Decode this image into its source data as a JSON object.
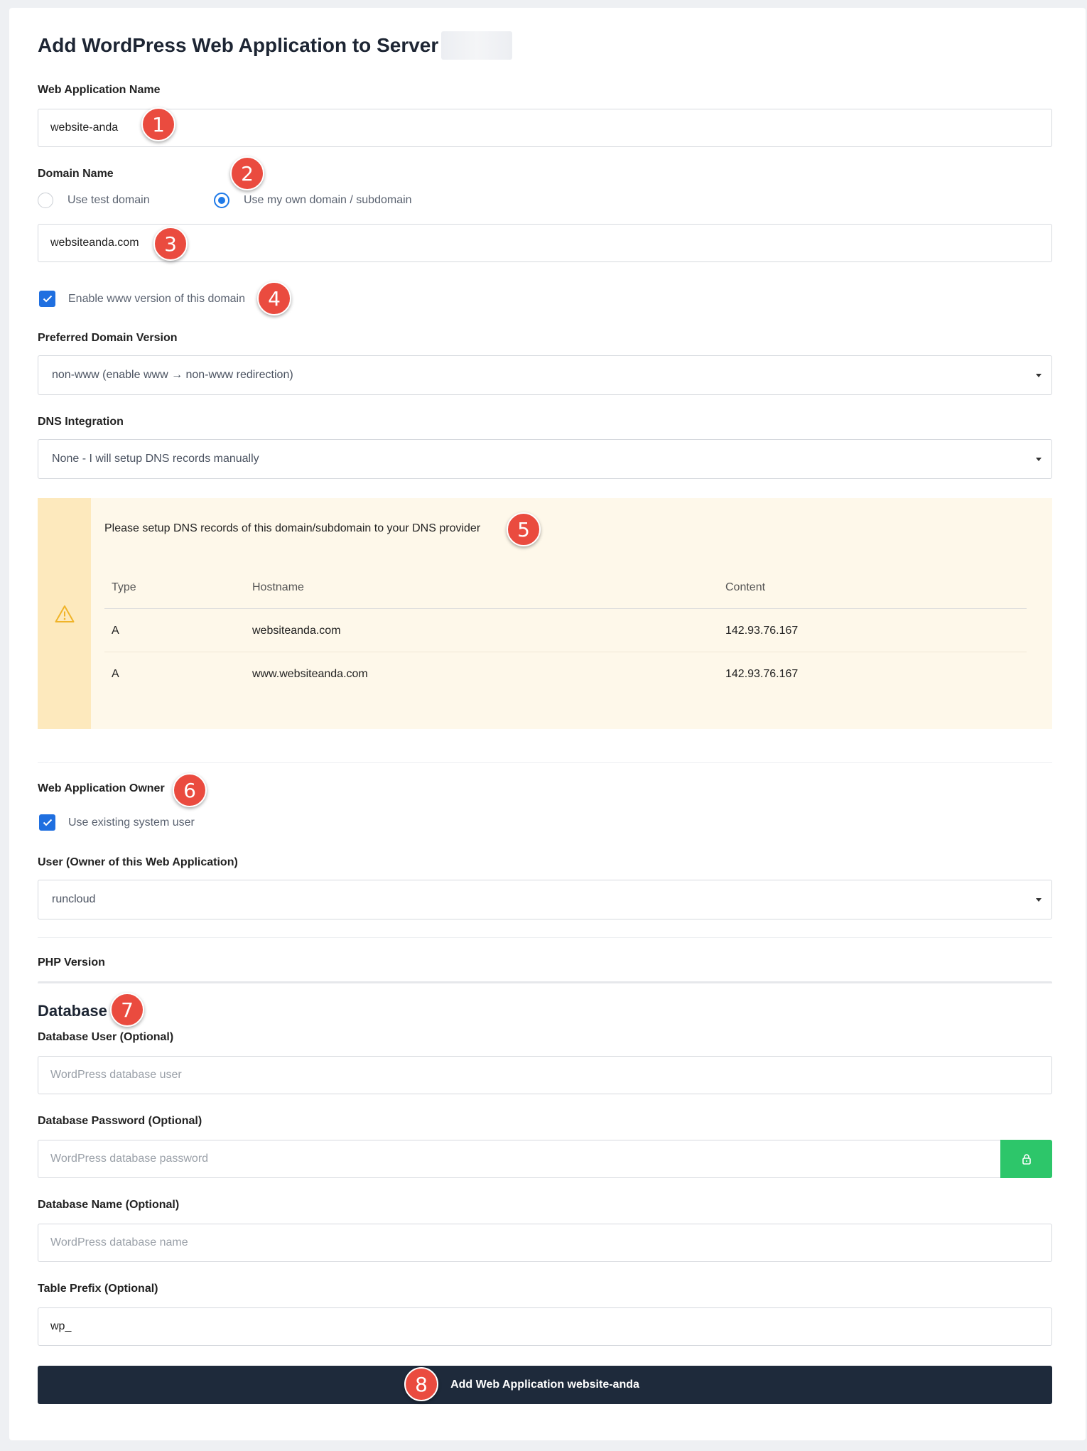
{
  "page": {
    "title": "Add WordPress Web Application to Server"
  },
  "app_name": {
    "label": "Web Application Name",
    "value": "website-anda"
  },
  "domain": {
    "label": "Domain Name",
    "option_test": "Use test domain",
    "option_own": "Use my own domain / subdomain",
    "selected": "Use my own domain / subdomain",
    "value": "websiteanda.com",
    "enable_www_label": "Enable www version of this domain",
    "enable_www_checked": true
  },
  "preferred": {
    "label": "Preferred Domain Version",
    "value": "non-www (enable www → non-www redirection)"
  },
  "dns_integration": {
    "label": "DNS Integration",
    "value": "None - I will setup DNS records manually"
  },
  "dns_notice": {
    "message": "Please setup DNS records of this domain/subdomain to your DNS provider",
    "headers": [
      "Type",
      "Hostname",
      "Content"
    ],
    "rows": [
      [
        "A",
        "websiteanda.com",
        "142.93.76.167"
      ],
      [
        "A",
        "www.websiteanda.com",
        "142.93.76.167"
      ]
    ]
  },
  "owner": {
    "label": "Web Application Owner",
    "use_existing_label": "Use existing system user",
    "use_existing_checked": true,
    "user_label": "User (Owner of this Web Application)",
    "user_value": "runcloud"
  },
  "php": {
    "label": "PHP Version"
  },
  "database": {
    "heading": "Database",
    "user_label": "Database User (Optional)",
    "user_placeholder": "WordPress database user",
    "password_label": "Database Password (Optional)",
    "password_placeholder": "WordPress database password",
    "name_label": "Database Name (Optional)",
    "name_placeholder": "WordPress database name",
    "prefix_label": "Table Prefix (Optional)",
    "prefix_value": "wp_"
  },
  "submit_label": "Add Web Application website-anda",
  "annotations": [
    "1",
    "2",
    "3",
    "4",
    "5",
    "6",
    "7",
    "8"
  ],
  "colors": {
    "accent_blue": "#1f7ae8",
    "badge_red": "#ea4b3f",
    "notice_bg": "#fef8ea",
    "notice_side": "#fde9bd",
    "lock_green": "#2dc66a",
    "submit_bg": "#1e2a3b"
  }
}
